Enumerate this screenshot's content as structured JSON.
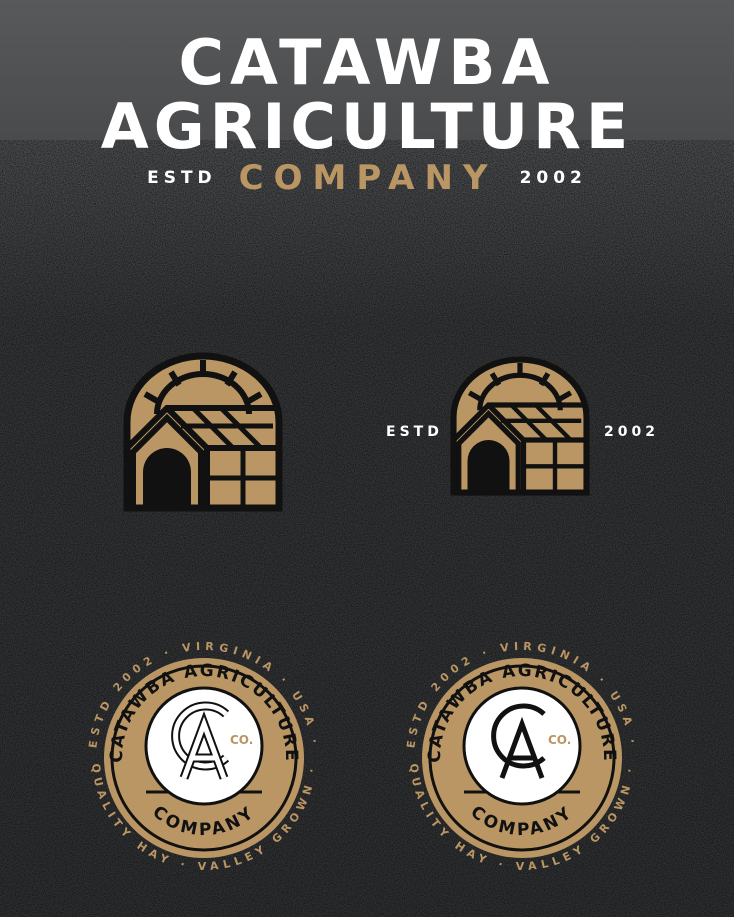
{
  "brand": {
    "name_line1": "CATAWBA",
    "name_line2": "AGRICULTURE",
    "company": "COMPANY",
    "estd": "ESTD",
    "year": "2002"
  },
  "secondary_mark": {
    "left": "ESTD",
    "right": "2002"
  },
  "badge": {
    "outer_top": "ESTD 2002 · VIRGINIA · USA ·",
    "outer_bottom": "QUALITY HAY · VALLEY GROWN ·",
    "inner_top": "CATAWBA AGRICULTURE",
    "inner_bottom": "COMPANY",
    "co": "CO."
  },
  "colors": {
    "background": "#3a3b3d",
    "gold": "#b99663",
    "black": "#111111",
    "white": "#ffffff"
  }
}
